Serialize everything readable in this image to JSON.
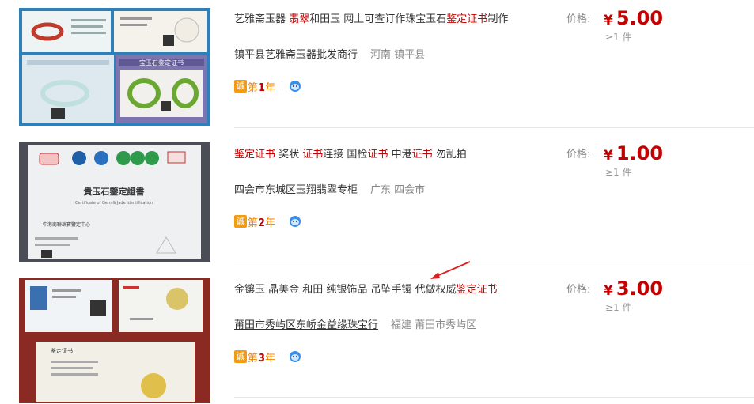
{
  "results": [
    {
      "title_parts": [
        {
          "text": "艺雅斋玉器 ",
          "hl": false
        },
        {
          "text": "翡翠",
          "hl": true
        },
        {
          "text": "和田玉 网上可查订作珠宝玉石",
          "hl": false
        },
        {
          "text": "鉴定证书",
          "hl": true
        },
        {
          "text": "制作",
          "hl": false
        }
      ],
      "company": "镇平县艺雅斋玉器批发商行",
      "location": "河南 镇平县",
      "cheng": "诚",
      "year_prefix": "第",
      "year_num": "1",
      "year_suffix": "年",
      "price_label": "价格:",
      "currency": "¥",
      "price": "5.00",
      "moq": "≥1 件"
    },
    {
      "title_parts": [
        {
          "text": "鉴定证书",
          "hl": true
        },
        {
          "text": " 奖状 ",
          "hl": false
        },
        {
          "text": "证书",
          "hl": true
        },
        {
          "text": "连接 国检",
          "hl": false
        },
        {
          "text": "证书",
          "hl": true
        },
        {
          "text": " 中港",
          "hl": false
        },
        {
          "text": "证书",
          "hl": true
        },
        {
          "text": " 勿乱拍",
          "hl": false
        }
      ],
      "company": "四会市东城区玉翔翡翠专柜",
      "location": "广东 四会市",
      "cheng": "诚",
      "year_prefix": "第",
      "year_num": "2",
      "year_suffix": "年",
      "price_label": "价格:",
      "currency": "¥",
      "price": "1.00",
      "moq": "≥1 件"
    },
    {
      "title_parts": [
        {
          "text": "金镶玉 晶美金 和田 纯银饰品 吊坠手镯 代做权威",
          "hl": false
        },
        {
          "text": "鉴定证书",
          "hl": true
        }
      ],
      "company": "莆田市秀屿区东峤金益缘珠宝行",
      "location": "福建 莆田市秀屿区",
      "cheng": "诚",
      "year_prefix": "第",
      "year_num": "3",
      "year_suffix": "年",
      "price_label": "价格:",
      "currency": "¥",
      "price": "3.00",
      "moq": "≥1 件"
    }
  ],
  "thumb_texts": {
    "cert1_header": "宝玉石鉴定证书",
    "cert2_title": "貴玉石鑒定證書",
    "cert2_subtitle": "Certificate of Gem & Jade Identification",
    "cert2_issuer": "中港南聯珠寶鑒定中心",
    "cert3_header": "鉴定证书"
  },
  "colors": {
    "accent": "#c40000",
    "orange": "#f08300",
    "separator": "#e8e8e8"
  }
}
